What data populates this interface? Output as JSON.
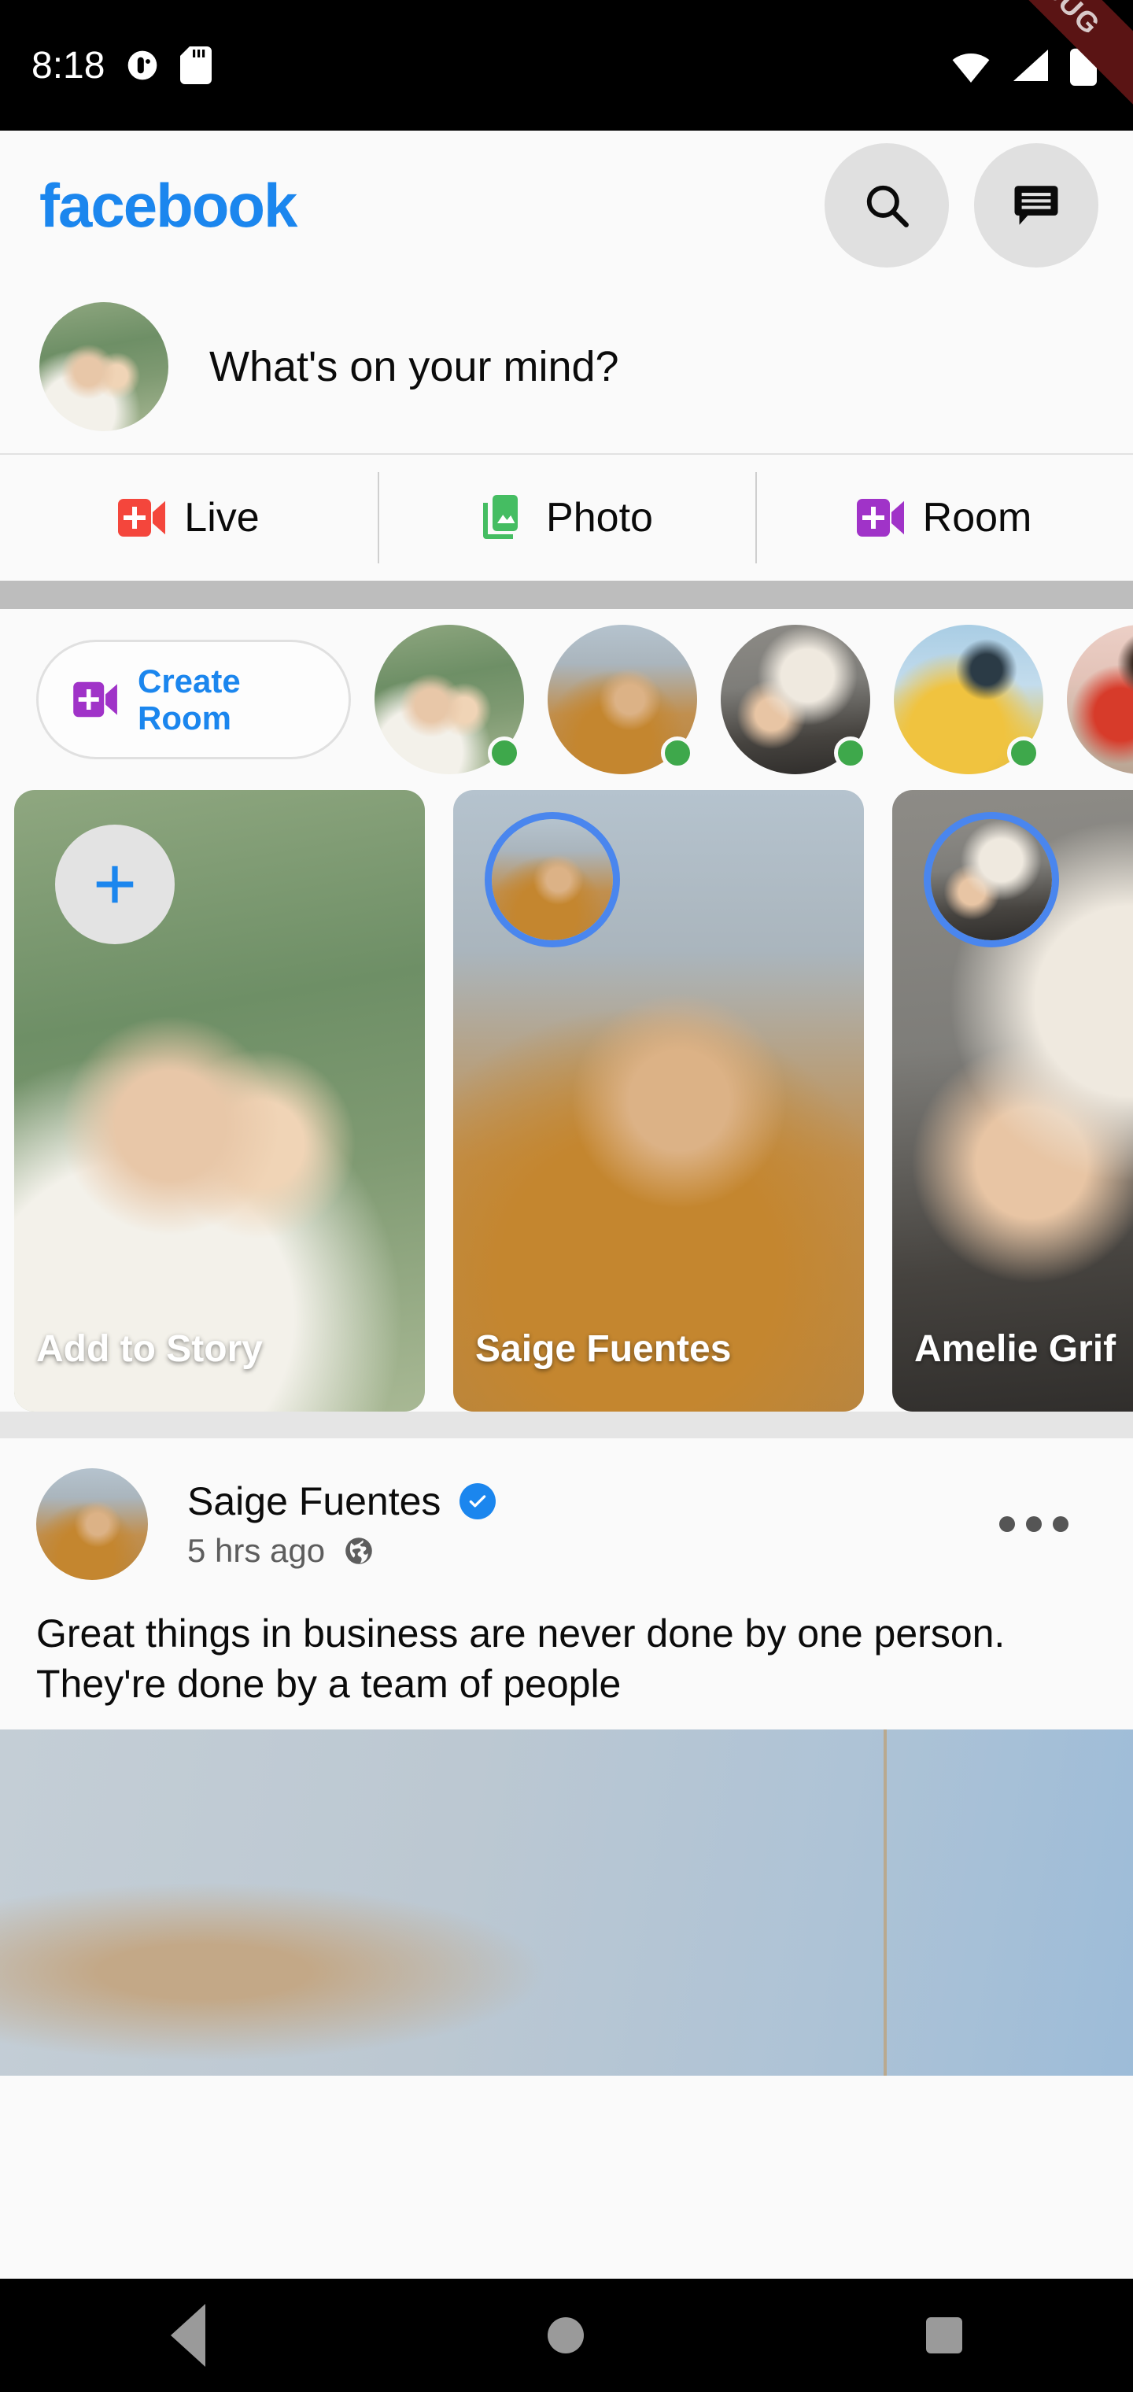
{
  "status_bar": {
    "time": "8:18",
    "icons_left": [
      "notification-icon",
      "sd-card-icon"
    ],
    "icons_right": [
      "wifi-icon",
      "cellular-signal-icon",
      "battery-icon"
    ],
    "debug_banner": "DEBUG"
  },
  "header": {
    "logo": "facebook",
    "logo_color": "#1b86ee",
    "search_label": "search-icon",
    "messenger_label": "messenger-icon"
  },
  "composer": {
    "placeholder": "What's on your mind?",
    "avatar_alt": "mother-holding-child-avatar"
  },
  "actions": [
    {
      "label": "Live",
      "icon": "live-video-icon",
      "color": "#f4463c"
    },
    {
      "label": "Photo",
      "icon": "photo-library-icon",
      "color": "#45bd62"
    },
    {
      "label": "Room",
      "icon": "room-video-icon",
      "color": "#a033c8"
    }
  ],
  "rooms": {
    "create_room_line1": "Create",
    "create_room_line2": "Room",
    "create_room_icon": "room-video-icon",
    "create_room_color": "#a033c8",
    "online_status_color": "#3ea84b",
    "avatars": [
      {
        "alt": "mother-and-child-avatar",
        "online": true
      },
      {
        "alt": "saige-fuentes-avatar",
        "online": true
      },
      {
        "alt": "amelie-griffin-avatar",
        "online": true
      },
      {
        "alt": "yellow-dress-avatar",
        "online": true
      },
      {
        "alt": "red-jacket-sunglasses-avatar",
        "online": true
      }
    ]
  },
  "stories": [
    {
      "label": "Add to Story",
      "type": "add",
      "plus_color": "#1b86ee",
      "alt": "mother-holding-child-photo"
    },
    {
      "label": "Saige Fuentes",
      "type": "story",
      "ring_color": "#4a86ee",
      "alt": "woman-in-reeds-photo"
    },
    {
      "label": "Amelie Grif",
      "type": "story",
      "ring_color": "#4a86ee",
      "alt": "blonde-woman-profile-photo"
    }
  ],
  "post": {
    "author": "Saige Fuentes",
    "verified": true,
    "verified_color": "#1b86ee",
    "timestamp": "5 hrs ago",
    "audience_icon": "globe-public-icon",
    "menu_icon": "more-options-icon",
    "text": "Great things in business are never done by one person. They're done by a team of people",
    "image_alt": "blue-sky-with-reeds-photo"
  },
  "nav_bar": {
    "items": [
      {
        "name": "back",
        "icon": "back-triangle-icon"
      },
      {
        "name": "home",
        "icon": "home-circle-icon"
      },
      {
        "name": "recents",
        "icon": "recents-square-icon"
      }
    ],
    "icon_color": "#9a9a9a"
  }
}
